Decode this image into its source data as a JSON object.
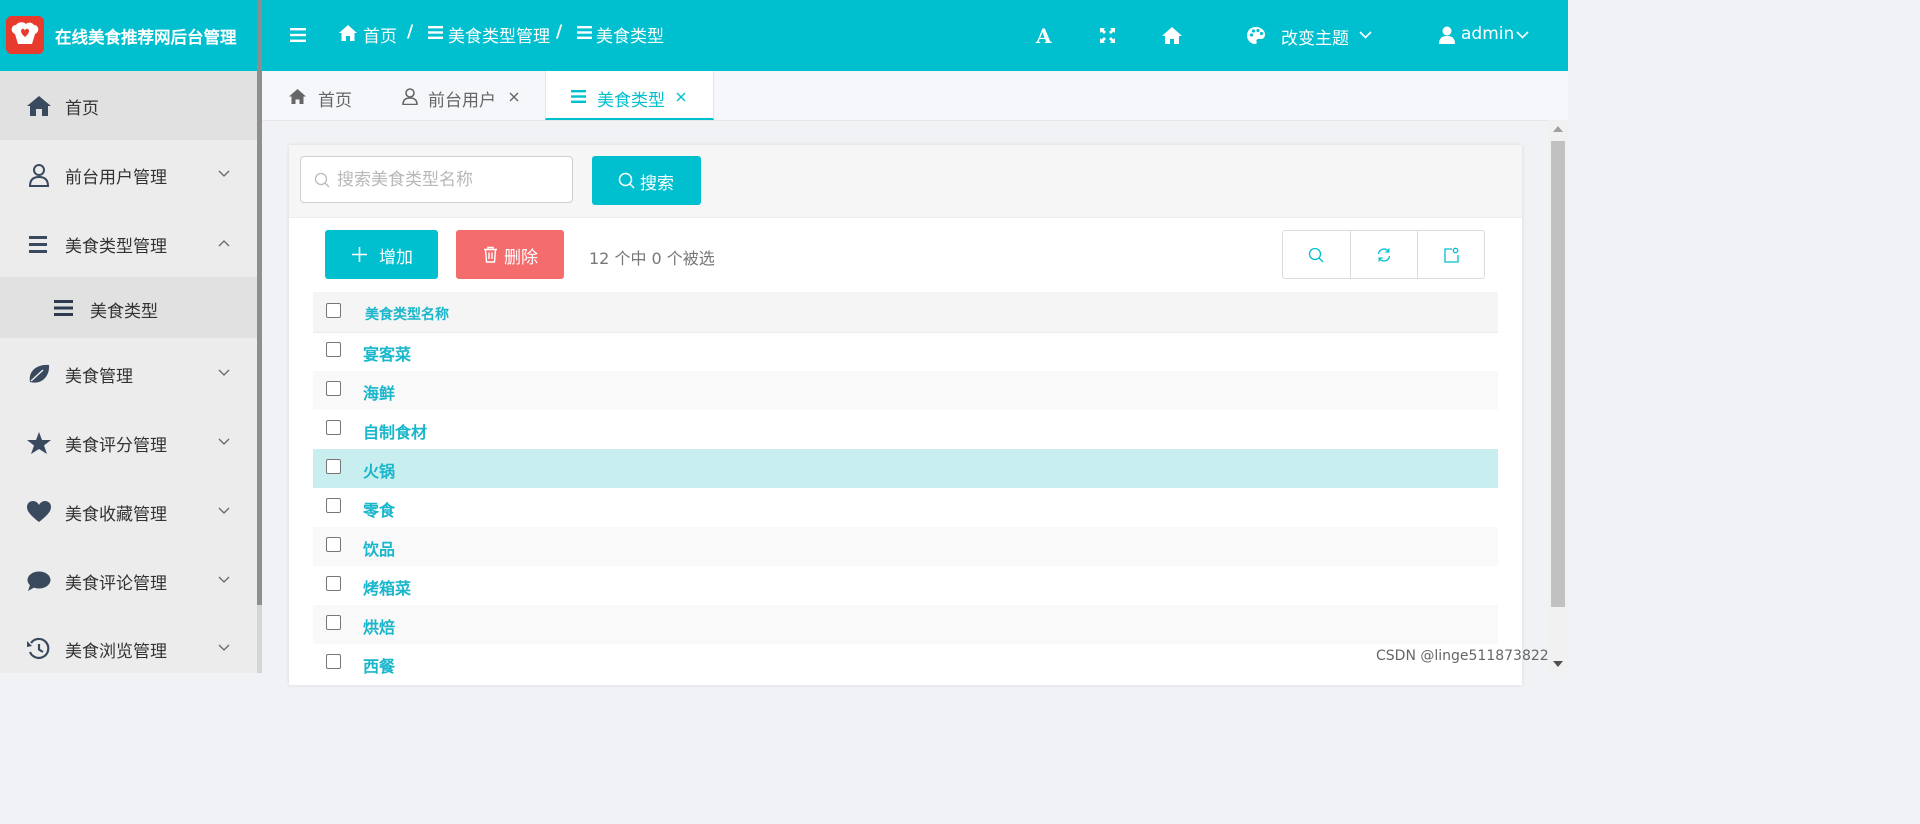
{
  "app": {
    "title": "在线美食推荐网后台管理"
  },
  "sidebar": {
    "items": [
      {
        "label": "首页",
        "icon": "home-icon"
      },
      {
        "label": "前台用户管理",
        "icon": "user-icon"
      },
      {
        "label": "美食类型管理",
        "icon": "list-icon",
        "expanded": true
      },
      {
        "label": "美食管理",
        "icon": "leaf-icon"
      },
      {
        "label": "美食评分管理",
        "icon": "star-icon"
      },
      {
        "label": "美食收藏管理",
        "icon": "heart-icon"
      },
      {
        "label": "美食评论管理",
        "icon": "comment-icon"
      },
      {
        "label": "美食浏览管理",
        "icon": "history-icon"
      }
    ],
    "subitem": {
      "label": "美食类型",
      "icon": "list-icon"
    }
  },
  "header": {
    "breadcrumb": [
      "首页",
      "美食类型管理",
      "美食类型"
    ],
    "separator": "/",
    "theme_label": "改变主题",
    "user_label": "admin",
    "font_glyph": "A"
  },
  "tabs": [
    {
      "label": "首页",
      "icon": "home-icon",
      "closable": false,
      "active": false
    },
    {
      "label": "前台用户",
      "icon": "user-icon",
      "closable": true,
      "active": false
    },
    {
      "label": "美食类型",
      "icon": "list-icon",
      "closable": true,
      "active": true
    }
  ],
  "search": {
    "placeholder": "搜索美食类型名称",
    "value": "",
    "button_label": "搜索"
  },
  "toolbar": {
    "add_label": "增加",
    "delete_label": "删除",
    "selection_text": "12 个中 0 个被选"
  },
  "table": {
    "column": "美食类型名称",
    "rows": [
      "宴客菜",
      "海鲜",
      "自制食材",
      "火锅",
      "零食",
      "饮品",
      "烤箱菜",
      "烘焙",
      "西餐"
    ],
    "highlighted_row": 3
  },
  "watermark": "CSDN @linge511873822",
  "colors": {
    "primary": "#00bfcf",
    "danger": "#f56c6c",
    "sidebar_bg": "#ececec",
    "row_highlight": "#c8eef0"
  }
}
